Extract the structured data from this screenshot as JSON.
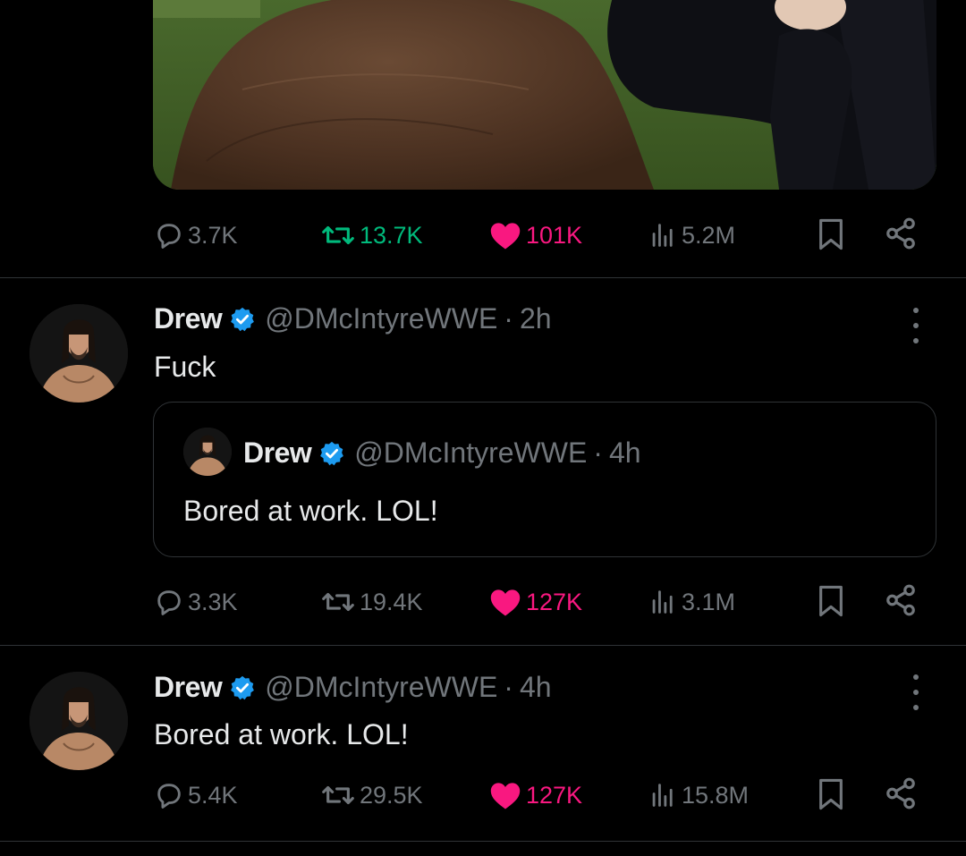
{
  "top_tweet": {
    "stats": {
      "replies": "3.7K",
      "reposts": "13.7K",
      "likes": "101K",
      "views": "5.2M"
    },
    "icons": [
      "reply-icon",
      "repost-icon",
      "like-icon",
      "views-icon",
      "bookmark-icon",
      "share-icon"
    ]
  },
  "tweet1": {
    "name": "Drew",
    "handle": "@DMcIntyreWWE",
    "separator": "·",
    "time": "2h",
    "text": "Fuck",
    "quote": {
      "name": "Drew",
      "handle": "@DMcIntyreWWE",
      "separator": "·",
      "time": "4h",
      "text": "Bored at work. LOL!"
    },
    "stats": {
      "replies": "3.3K",
      "reposts": "19.4K",
      "likes": "127K",
      "views": "3.1M"
    }
  },
  "tweet2": {
    "name": "Drew",
    "handle": "@DMcIntyreWWE",
    "separator": "·",
    "time": "4h",
    "text": "Bored at work. LOL!",
    "stats": {
      "replies": "5.4K",
      "reposts": "29.5K",
      "likes": "127K",
      "views": "15.8M"
    }
  },
  "colors": {
    "background": "#000000",
    "text": "#e7e9ea",
    "muted": "#71767b",
    "divider": "#2f3336",
    "like": "#f91880",
    "repost_active": "#00ba7c",
    "verified": "#1d9bf0"
  }
}
